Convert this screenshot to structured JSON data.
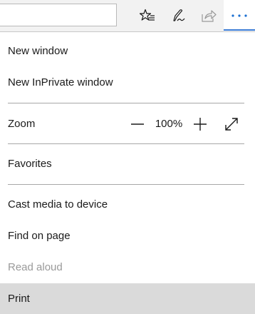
{
  "toolbar": {
    "address_value": "",
    "buttons": [
      "favorites-star-icon",
      "pen-icon",
      "share-icon",
      "more-dots-icon"
    ],
    "accent_color": "#3a7bd5"
  },
  "menu": {
    "new_window": "New window",
    "new_inprivate_window": "New InPrivate window",
    "zoom_label": "Zoom",
    "zoom_value": "100%",
    "favorites": "Favorites",
    "cast_media": "Cast media to device",
    "find_on_page": "Find on page",
    "read_aloud": "Read aloud",
    "print": "Print"
  }
}
